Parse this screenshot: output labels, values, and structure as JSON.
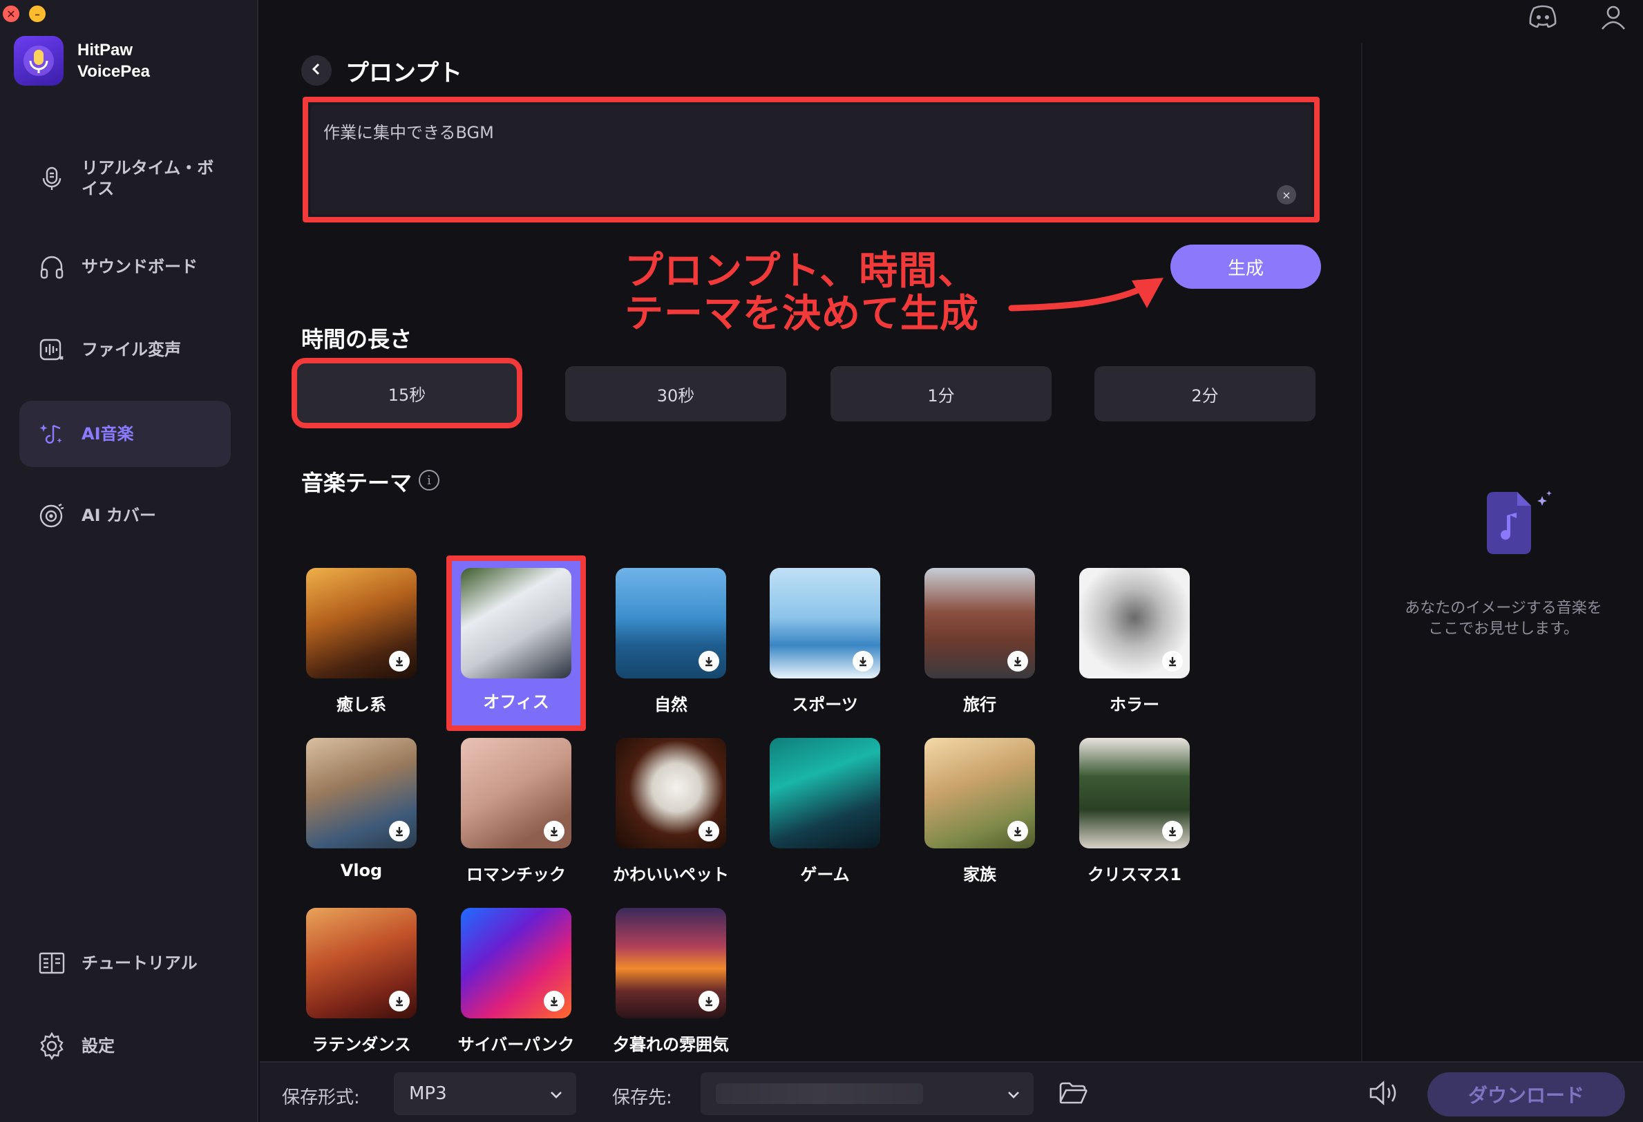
{
  "window": {
    "close_glyph": "✕",
    "minimize_glyph": "–"
  },
  "app": {
    "name_line1": "HitPaw",
    "name_line2": "VoicePea"
  },
  "sidebar": {
    "items": [
      {
        "label": "リアルタイム・ボイス",
        "icon": "mic-wave-icon"
      },
      {
        "label": "サウンドボード",
        "icon": "headphones-icon"
      },
      {
        "label": "ファイル変声",
        "icon": "file-voice-icon"
      },
      {
        "label": "AI音楽",
        "icon": "ai-music-icon",
        "active": true
      },
      {
        "label": "AI カバー",
        "icon": "vinyl-icon"
      }
    ],
    "bottom_items": [
      {
        "label": "チュートリアル",
        "icon": "book-icon"
      },
      {
        "label": "設定",
        "icon": "gear-icon"
      }
    ]
  },
  "main": {
    "title": "プロンプト",
    "prompt_value": "作業に集中できるBGM",
    "clear_glyph": "×",
    "generate_label": "生成",
    "annotation_line1": "プロンプト、時間、",
    "annotation_line2": "テーマを決めて生成",
    "duration_title": "時間の長さ",
    "durations": [
      "15秒",
      "30秒",
      "1分",
      "2分"
    ],
    "selected_duration": "15秒",
    "theme_title": "音楽テーマ",
    "info_glyph": "i",
    "themes": [
      {
        "name": "癒し系",
        "selected": false
      },
      {
        "name": "オフィス",
        "selected": true
      },
      {
        "name": "自然",
        "selected": false
      },
      {
        "name": "スポーツ",
        "selected": false
      },
      {
        "name": "旅行",
        "selected": false
      },
      {
        "name": "ホラー",
        "selected": false
      },
      {
        "name": "Vlog",
        "selected": false
      },
      {
        "name": "ロマンチック",
        "selected": false
      },
      {
        "name": "かわいいペット",
        "selected": false
      },
      {
        "name": "ゲーム",
        "selected": false
      },
      {
        "name": "家族",
        "selected": false
      },
      {
        "name": "クリスマス1",
        "selected": false
      },
      {
        "name": "ラテンダンス",
        "selected": false
      },
      {
        "name": "サイバーパンク",
        "selected": false
      },
      {
        "name": "夕暮れの雰囲気",
        "selected": false
      }
    ]
  },
  "right_panel": {
    "message_line1": "あなたのイメージする音楽を",
    "message_line2": "ここでお見せします。"
  },
  "bottom_bar": {
    "format_label": "保存形式:",
    "format_value": "MP3",
    "destination_label": "保存先:",
    "destination_value": "",
    "download_label": "ダウンロード"
  },
  "colors": {
    "accent": "#8b78fb",
    "highlight_red": "#f23a3a",
    "background": "#111116",
    "sidebar": "#1d1c24"
  }
}
